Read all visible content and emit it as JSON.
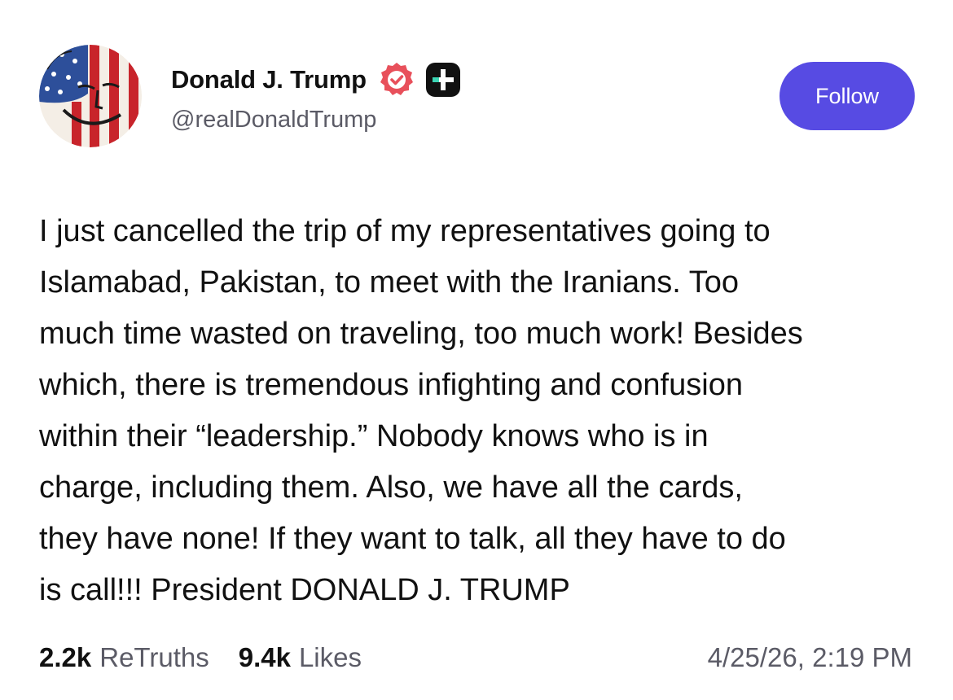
{
  "author": {
    "display_name": "Donald J. Trump",
    "handle": "@realDonaldTrump",
    "avatar_icon": "avatar-flag-portrait",
    "verified_icon": "verified-badge-icon",
    "plus_icon": "truth-plus-icon",
    "verified_color": "#e8505b",
    "plus_color": "#111111"
  },
  "follow": {
    "label": "Follow",
    "color": "#574be3"
  },
  "post": {
    "text": "I just cancelled the trip of my representatives going to\nIslamabad, Pakistan, to meet with the Iranians. Too\nmuch time wasted on traveling, too much work! Besides\nwhich, there is tremendous infighting and confusion\nwithin their “leadership.” Nobody knows who is in\ncharge, including them. Also, we have all the cards,\nthey have none! If they want to talk, all they have to do\nis call!!! President DONALD J. TRUMP"
  },
  "stats": {
    "retruths_count": "2.2k",
    "retruths_label": "ReTruths",
    "likes_count": "9.4k",
    "likes_label": "Likes"
  },
  "timestamp": "4/25/26, 2:19 PM"
}
